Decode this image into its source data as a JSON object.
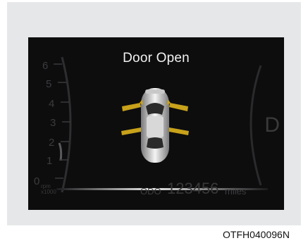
{
  "cluster": {
    "message": "Door Open",
    "tachometer_numbers": [
      "6",
      "5",
      "4",
      "3",
      "2",
      "1",
      "0"
    ],
    "rpm_label": "rpm",
    "rpm_multiplier": "x1000",
    "gear": "D",
    "odometer": {
      "label": "ODO",
      "value": "123456",
      "unit": "miles"
    },
    "door_status": {
      "front_left": "open",
      "front_right": "open",
      "rear_left": "open",
      "rear_right": "open"
    },
    "colors": {
      "background": "#0d0d0e",
      "door_indicator": "#c8a21a",
      "message_text": "#f2f2f2"
    }
  },
  "caption": "OTFH040096N"
}
